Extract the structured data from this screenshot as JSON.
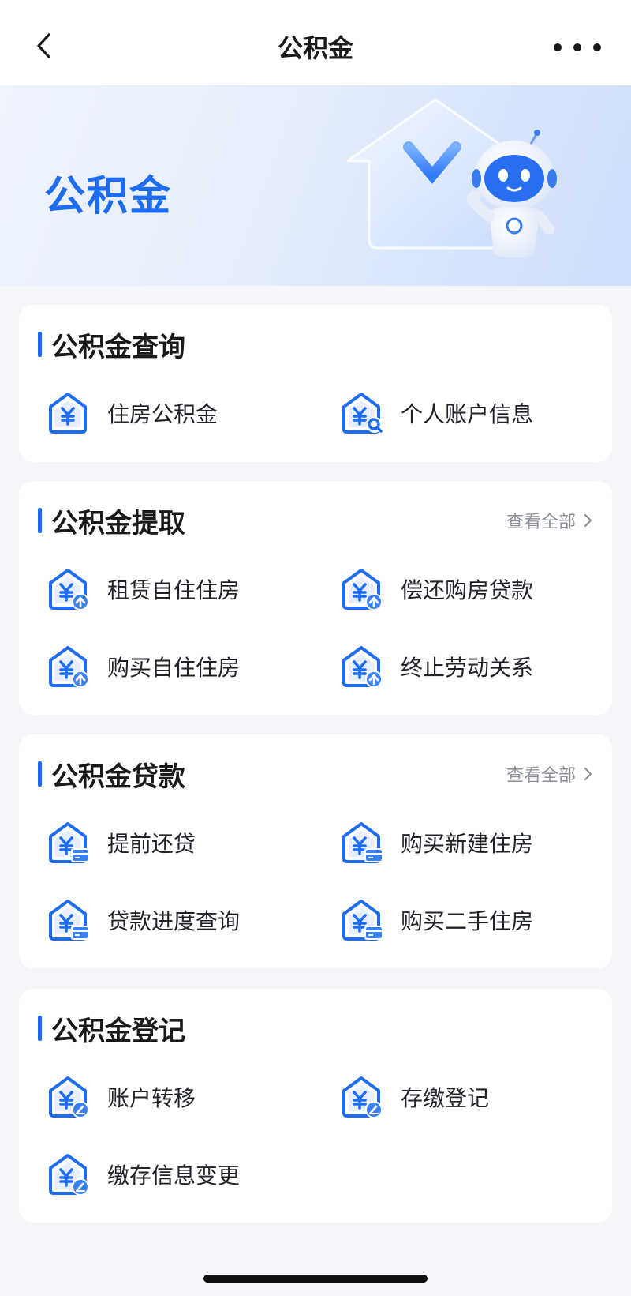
{
  "nav": {
    "title": "公积金"
  },
  "banner": {
    "title": "公积金"
  },
  "colors": {
    "accent": "#1d6cf2",
    "icon_light": "#5b9bf8",
    "background": "#f4f6f9"
  },
  "sections": [
    {
      "title": "公积金查询",
      "view_all": "",
      "items": [
        {
          "label": "住房公积金",
          "icon": "house-yuan-icon"
        },
        {
          "label": "个人账户信息",
          "icon": "house-yuan-search-icon"
        }
      ]
    },
    {
      "title": "公积金提取",
      "view_all": "查看全部",
      "items": [
        {
          "label": "租赁自住住房",
          "icon": "house-yuan-upload-icon"
        },
        {
          "label": "偿还购房贷款",
          "icon": "house-yuan-upload-icon"
        },
        {
          "label": "购买自住住房",
          "icon": "house-yuan-upload-icon"
        },
        {
          "label": "终止劳动关系",
          "icon": "house-yuan-upload-icon"
        }
      ]
    },
    {
      "title": "公积金贷款",
      "view_all": "查看全部",
      "items": [
        {
          "label": "提前还贷",
          "icon": "house-yuan-card-icon"
        },
        {
          "label": "购买新建住房",
          "icon": "house-yuan-card-icon"
        },
        {
          "label": "贷款进度查询",
          "icon": "house-yuan-card-icon"
        },
        {
          "label": "购买二手住房",
          "icon": "house-yuan-card-icon"
        }
      ]
    },
    {
      "title": "公积金登记",
      "view_all": "",
      "items": [
        {
          "label": "账户转移",
          "icon": "house-yuan-edit-icon"
        },
        {
          "label": "存缴登记",
          "icon": "house-yuan-edit-icon"
        },
        {
          "label": "缴存信息变更",
          "icon": "house-yuan-edit-icon"
        }
      ]
    }
  ]
}
